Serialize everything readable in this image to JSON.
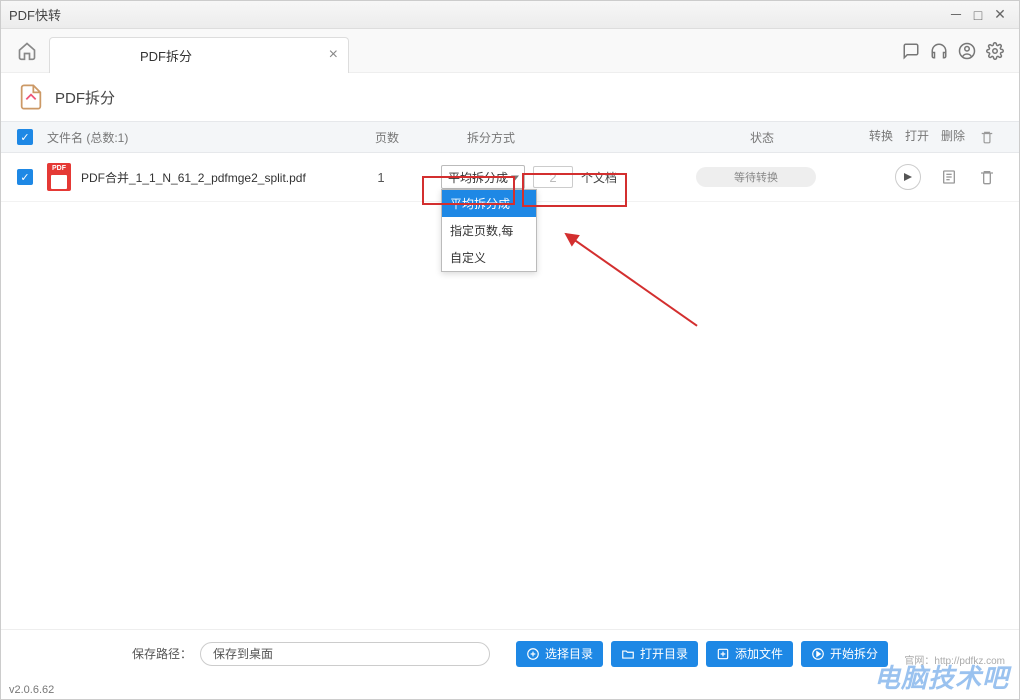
{
  "app": {
    "title": "PDF快转"
  },
  "tab": {
    "label": "PDF拆分"
  },
  "page": {
    "heading": "PDF拆分"
  },
  "columns": {
    "filename": "文件名 (总数:1)",
    "pages": "页数",
    "split_mode": "拆分方式",
    "status": "状态",
    "convert": "转换",
    "open": "打开",
    "delete": "删除"
  },
  "row": {
    "filename": "PDF合并_1_1_N_61_2_pdfmge2_split.pdf",
    "pages": "1",
    "split_selected": "平均拆分成",
    "split_count": "2",
    "split_suffix": "个文档",
    "status": "等待转换"
  },
  "dropdown": {
    "opt1": "平均拆分成",
    "opt2": "指定页数,每",
    "opt3": "自定义"
  },
  "footer": {
    "path_label": "保存路径：",
    "path_value": "保存到桌面",
    "choose_dir": "选择目录",
    "open_dir": "打开目录",
    "add_file": "添加文件",
    "start_split": "开始拆分"
  },
  "version": "v2.0.6.62",
  "watermark": "电脑技术吧",
  "watermark_sub": "官网：http://pdfkz.com"
}
